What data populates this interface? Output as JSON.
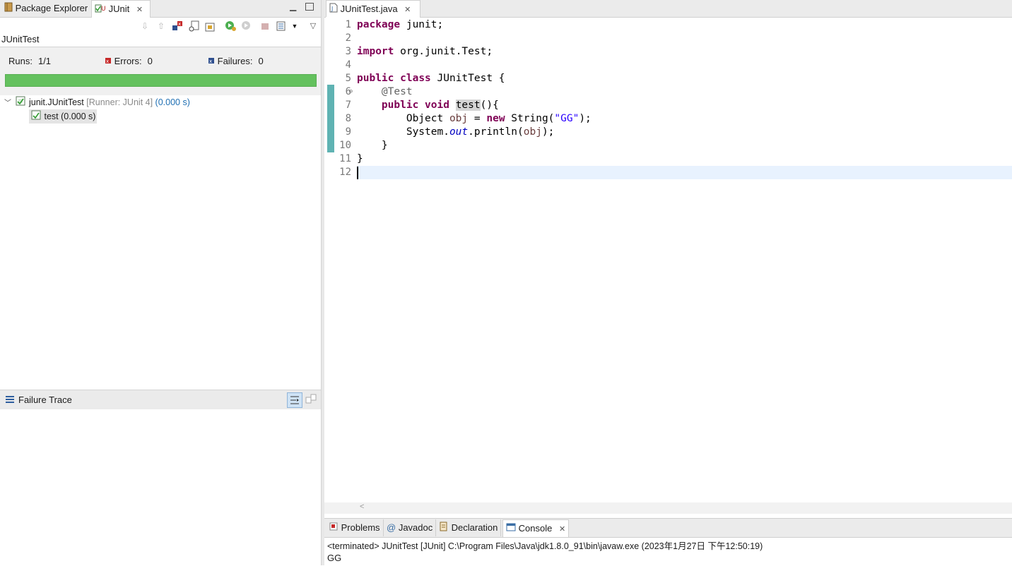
{
  "left_tabs": {
    "package_explorer": "Package Explorer",
    "junit": "JUnit"
  },
  "junit": {
    "title": "JUnitTest",
    "runs_label": "Runs:",
    "runs_value": "1/1",
    "errors_label": "Errors:",
    "errors_value": "0",
    "failures_label": "Failures:",
    "failures_value": "0",
    "progress_fraction": 1.0,
    "tree": {
      "suite_name": "junit.JUnitTest",
      "suite_runner": "[Runner: JUnit 4]",
      "suite_time": "(0.000 s)",
      "test_label": "test (0.000 s)"
    },
    "failure_trace_label": "Failure Trace"
  },
  "editor": {
    "tab_label": "JUnitTest.java",
    "line_numbers": [
      "1",
      "2",
      "3",
      "4",
      "5",
      "6",
      "7",
      "8",
      "9",
      "10",
      "11",
      "12"
    ],
    "current_line": 12
  },
  "console": {
    "tabs": {
      "problems": "Problems",
      "javadoc": "Javadoc",
      "declaration": "Declaration",
      "console": "Console"
    },
    "status": "<terminated> JUnitTest [JUnit] C:\\Program Files\\Java\\jdk1.8.0_91\\bin\\javaw.exe (2023年1月27日 下午12:50:19)",
    "output": "GG"
  },
  "code_tokens": {
    "l1_kw": "package",
    "l1_rest": " junit;",
    "l3_kw": "import",
    "l3_rest": " org.junit.Test;",
    "l5_kw1": "public",
    "l5_kw2": "class",
    "l5_rest": " JUnitTest {",
    "l6_ann": "@Test",
    "l7_kw1": "public",
    "l7_kw2": "void",
    "l7_name": "test",
    "l7_rest": "(){",
    "l8_type": "Object ",
    "l8_var": "obj",
    "l8_eq": " = ",
    "l8_kw": "new",
    "l8_call": " String(",
    "l8_str": "\"GG\"",
    "l8_end": ");",
    "l9_a": "System.",
    "l9_fld": "out",
    "l9_b": ".println(",
    "l9_var": "obj",
    "l9_c": ");",
    "l10": "}",
    "l11": "}"
  },
  "colors": {
    "progress_green": "#64c15e",
    "keyword": "#7f0055",
    "string": "#2a00ff",
    "annotation": "#646464",
    "current_line": "#e8f2fe"
  }
}
